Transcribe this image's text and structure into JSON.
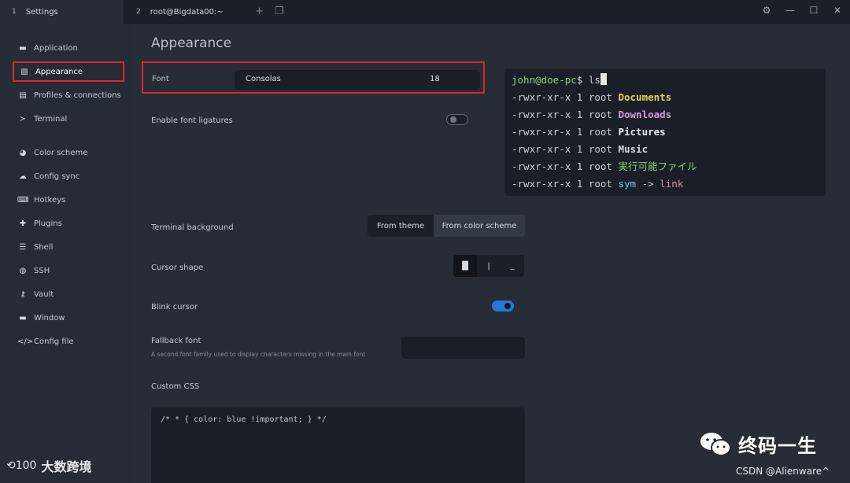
{
  "tabs": [
    {
      "num": "1",
      "label": "Settings"
    },
    {
      "num": "2",
      "label": "root@Bigdata00:~"
    }
  ],
  "tab_actions": {
    "add": "+",
    "window": "❐"
  },
  "window_controls": {
    "settings": "⚙",
    "minimize": "—",
    "maximize": "☐",
    "close": "✕"
  },
  "sidebar": {
    "items": [
      {
        "label": "Application",
        "icon": "window-icon"
      },
      {
        "label": "Appearance",
        "icon": "palette-icon"
      },
      {
        "label": "Profiles & connections",
        "icon": "list-icon"
      },
      {
        "label": "Terminal",
        "icon": "terminal-icon"
      },
      {
        "label": "Color scheme",
        "icon": "palette-icon"
      },
      {
        "label": "Config sync",
        "icon": "cloud-icon"
      },
      {
        "label": "Hotkeys",
        "icon": "keyboard-icon"
      },
      {
        "label": "Plugins",
        "icon": "puzzle-icon"
      },
      {
        "label": "Shell",
        "icon": "list-icon"
      },
      {
        "label": "SSH",
        "icon": "globe-icon"
      },
      {
        "label": "Vault",
        "icon": "key-icon"
      },
      {
        "label": "Window",
        "icon": "window-icon"
      },
      {
        "label": "Config file",
        "icon": "code-icon"
      }
    ],
    "icon_glyphs": [
      "▬",
      "▧",
      "▤",
      "≻",
      "◕",
      "☁",
      "⌨",
      "✚",
      "☰",
      "◍",
      "⚷",
      "▬",
      "</>"
    ]
  },
  "main": {
    "heading": "Appearance",
    "font": {
      "label": "Font",
      "family": "Consolas",
      "size": "18"
    },
    "ligatures": {
      "label": "Enable font ligatures",
      "enabled": false
    },
    "terminal_background": {
      "label": "Terminal background",
      "options": [
        "From theme",
        "From color scheme"
      ],
      "selected": "From color scheme"
    },
    "cursor_shape": {
      "label": "Cursor shape",
      "options": [
        "█",
        "|",
        "_"
      ],
      "selected_index": 0
    },
    "blink_cursor": {
      "label": "Blink cursor",
      "enabled": true
    },
    "fallback_font": {
      "label": "Fallback font",
      "description": "A second font family used to display characters missing in the main font",
      "value": ""
    },
    "custom_css": {
      "label": "Custom CSS",
      "value": "/* * { color: blue !important; } */"
    }
  },
  "terminal_preview": {
    "prompt_user": "john@doe-pc",
    "prompt_symbol": "$ ",
    "command": "ls",
    "perm": "-rwxr-xr-x 1 root ",
    "entries": [
      "Documents",
      "Downloads",
      "Pictures",
      "Music",
      "実行可能ファイル"
    ],
    "symlink": {
      "name": "sym",
      "arrow": " -> ",
      "target": "link"
    },
    "colors": {
      "accent": "#2a76d6",
      "highlight": "#e0262a"
    }
  },
  "watermarks": {
    "left_logo": "⟲100",
    "left_text": "大数跨境",
    "brand": "终码一生",
    "csdn": "CSDN @Alienware^"
  }
}
